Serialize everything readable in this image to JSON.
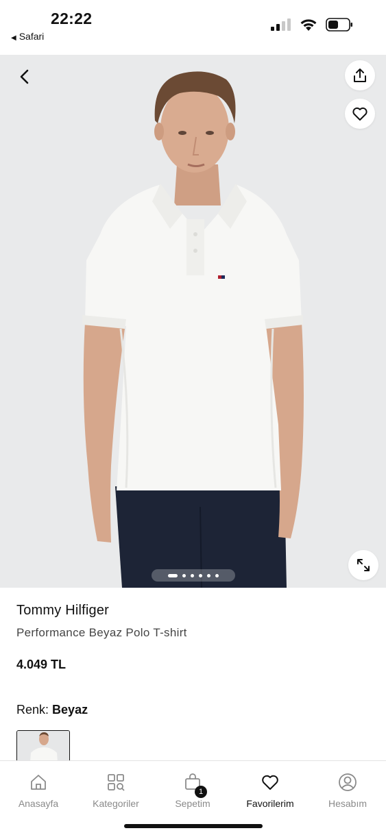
{
  "status_bar": {
    "time": "22:22",
    "back_app": "Safari"
  },
  "product": {
    "brand": "Tommy Hilfiger",
    "name": "Performance Beyaz Polo T-shirt",
    "price": "4.049 TL",
    "color_label": "Renk:",
    "color_value": "Beyaz",
    "image_count": 6,
    "active_image_index": 0
  },
  "actions": {
    "back_icon": "chevron-left-icon",
    "share_icon": "share-icon",
    "favorite_icon": "heart-icon",
    "expand_icon": "expand-icon"
  },
  "tabbar": {
    "items": [
      {
        "label": "Anasayfa",
        "icon": "home-icon"
      },
      {
        "label": "Kategoriler",
        "icon": "categories-icon"
      },
      {
        "label": "Sepetim",
        "icon": "cart-icon",
        "badge": "1"
      },
      {
        "label": "Favorilerim",
        "icon": "heart-icon",
        "active": true
      },
      {
        "label": "Hesabım",
        "icon": "account-icon"
      }
    ]
  },
  "colors": {
    "hero_background": "#e9eaeb",
    "text_primary": "#111111",
    "text_secondary": "#8a8a8a"
  }
}
